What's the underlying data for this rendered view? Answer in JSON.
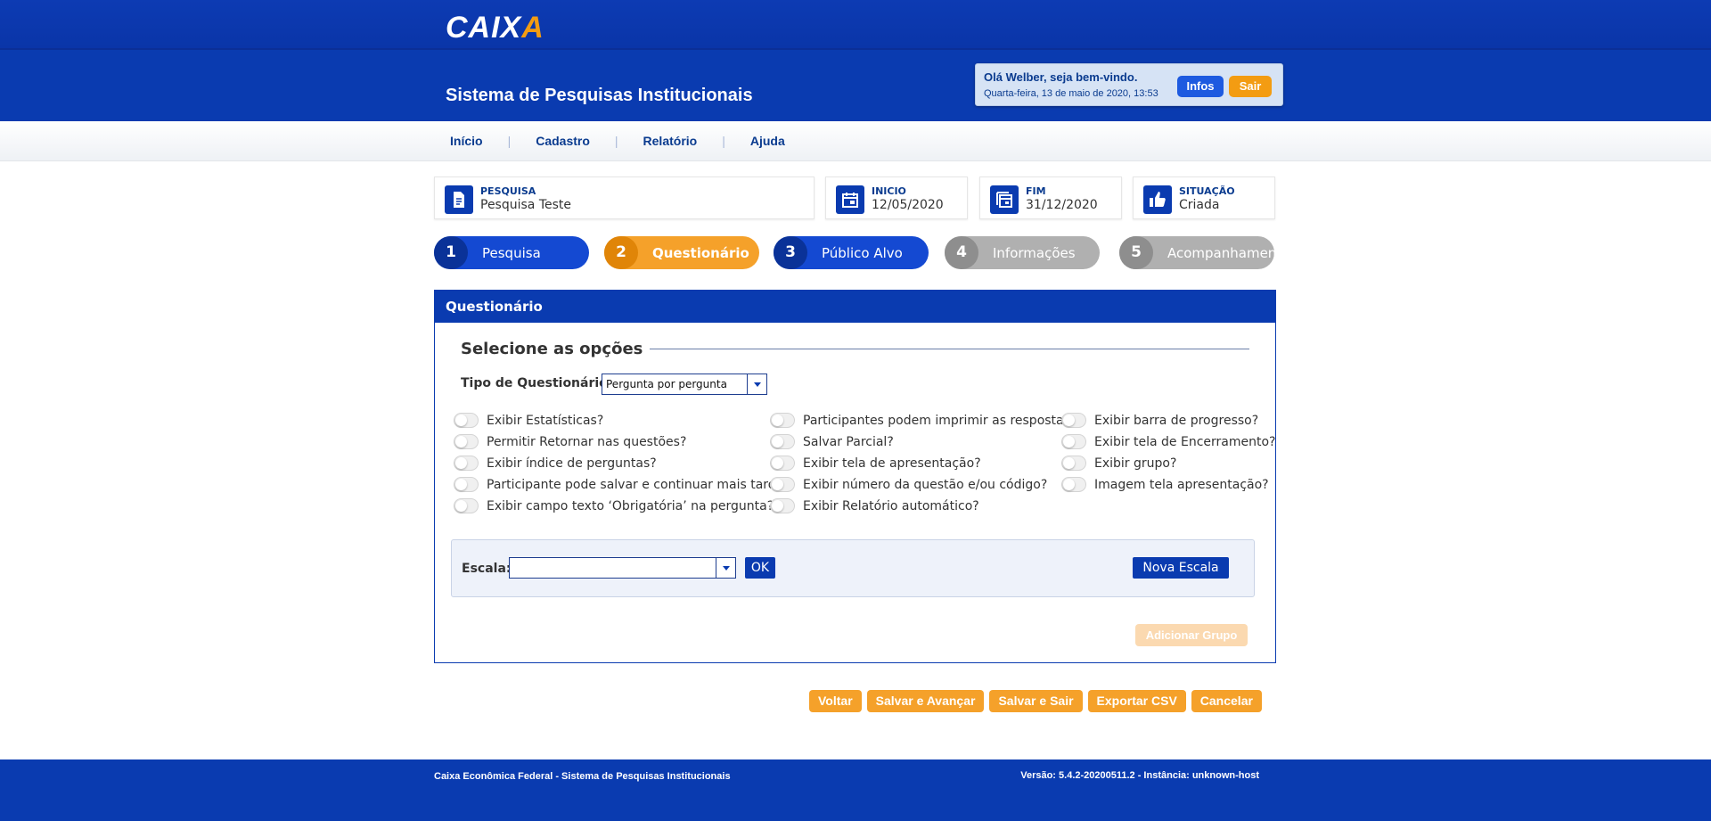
{
  "header": {
    "logo_main": "CAIX",
    "logo_accent": "A",
    "system_title": "Sistema de Pesquisas Institucionais",
    "greeting": "Olá Welber, seja bem-vindo.",
    "datetime": "Quarta-feira, 13 de maio de 2020, 13:53",
    "infos_label": "Infos",
    "sair_label": "Sair"
  },
  "menu": {
    "items": [
      "Início",
      "Cadastro",
      "Relatório",
      "Ajuda"
    ],
    "separator": "|"
  },
  "cards": [
    {
      "label": "PESQUISA",
      "value": "Pesquisa Teste",
      "icon": "document-icon"
    },
    {
      "label": "INICIO",
      "value": "12/05/2020",
      "icon": "calendar-icon"
    },
    {
      "label": "FIM",
      "value": "31/12/2020",
      "icon": "calendar-range-icon"
    },
    {
      "label": "SITUAÇÃO",
      "value": "Criada",
      "icon": "thumbs-up-icon"
    }
  ],
  "steps": [
    {
      "num": "1",
      "label": "Pesquisa",
      "state": "done"
    },
    {
      "num": "2",
      "label": "Questionário",
      "state": "active"
    },
    {
      "num": "3",
      "label": "Público Alvo",
      "state": "done"
    },
    {
      "num": "4",
      "label": "Informações",
      "state": "disabled"
    },
    {
      "num": "5",
      "label": "Acompanhamento",
      "state": "disabled"
    }
  ],
  "panel": {
    "title": "Questionário",
    "section_title": "Selecione as opções",
    "tipo_label": "Tipo de Questionário:",
    "tipo_value": "Pergunta por pergunta",
    "options": {
      "col1": [
        "Exibir Estatísticas?",
        "Permitir Retornar nas questões?",
        "Exibir índice de perguntas?",
        "Participante pode salvar e continuar mais tarde?",
        "Exibir campo texto ‘Obrigatória’ na pergunta?"
      ],
      "col2": [
        "Participantes podem imprimir as respostas?",
        "Salvar Parcial?",
        "Exibir tela de apresentação?",
        "Exibir número da questão e/ou código?",
        "Exibir  Relatório automático?"
      ],
      "col3": [
        "Exibir barra de progresso?",
        "Exibir tela de Encerramento?",
        "Exibir grupo?",
        "Imagem tela apresentação?"
      ]
    },
    "escala_label": "Escala:",
    "escala_value": "",
    "ok_label": "OK",
    "nova_escala_label": "Nova Escala",
    "adicionar_grupo_label": "Adicionar Grupo"
  },
  "actions": [
    "Voltar",
    "Salvar e Avançar",
    "Salvar e Sair",
    "Exportar CSV",
    "Cancelar"
  ],
  "footer": {
    "left": "Caixa Econômica Federal - Sistema de Pesquisas Institucionais",
    "right": "Versão: 5.4.2-20200511.2 - Instância: unknown-host"
  },
  "colors": {
    "brand_blue": "#0a3bb0",
    "accent_orange": "#f5a12a",
    "disabled_gray": "#b0b0b0"
  }
}
